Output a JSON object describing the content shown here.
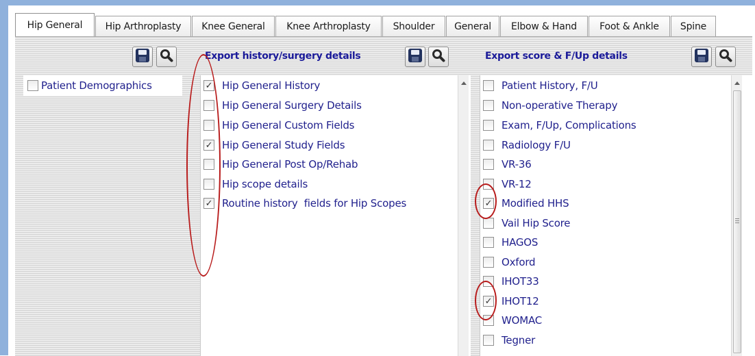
{
  "tabs": [
    {
      "label": "Hip General",
      "active": true
    },
    {
      "label": "Hip Arthroplasty",
      "active": false
    },
    {
      "label": "Knee General",
      "active": false
    },
    {
      "label": "Knee Arthroplasty",
      "active": false
    },
    {
      "label": "Shoulder",
      "active": false
    },
    {
      "label": "General",
      "active": false
    },
    {
      "label": "Elbow & Hand",
      "active": false
    },
    {
      "label": "Foot & Ankle",
      "active": false
    },
    {
      "label": "Spine",
      "active": false
    }
  ],
  "toolbar": {
    "icons": [
      "save-icon",
      "search-icon"
    ]
  },
  "left_panel": {
    "items": [
      {
        "label": "Patient Demographics",
        "checked": false
      }
    ]
  },
  "history_panel": {
    "title": "Export history/surgery details",
    "items": [
      {
        "label": "Hip General History",
        "checked": true
      },
      {
        "label": "Hip General Surgery Details",
        "checked": false
      },
      {
        "label": "Hip General Custom Fields",
        "checked": false
      },
      {
        "label": "Hip General Study Fields",
        "checked": true
      },
      {
        "label": "Hip General Post Op/Rehab",
        "checked": false
      },
      {
        "label": "Hip scope details",
        "checked": false
      },
      {
        "label": "Routine history  fields for Hip Scopes",
        "checked": true
      }
    ]
  },
  "score_panel": {
    "title": "Export score & F/Up details",
    "items": [
      {
        "label": "Patient History, F/U",
        "checked": false
      },
      {
        "label": "Non-operative Therapy",
        "checked": false
      },
      {
        "label": "Exam, F/Up, Complications",
        "checked": false
      },
      {
        "label": "Radiology F/U",
        "checked": false
      },
      {
        "label": "VR-36",
        "checked": false
      },
      {
        "label": "VR-12",
        "checked": false
      },
      {
        "label": "Modified HHS",
        "checked": true
      },
      {
        "label": "Vail Hip Score",
        "checked": false
      },
      {
        "label": "HAGOS",
        "checked": false
      },
      {
        "label": "Oxford",
        "checked": false
      },
      {
        "label": "IHOT33",
        "checked": false
      },
      {
        "label": "IHOT12",
        "checked": true
      },
      {
        "label": "WOMAC",
        "checked": false
      },
      {
        "label": "Tegner",
        "checked": false
      }
    ]
  },
  "colors": {
    "item_text": "#1f1f8c",
    "title_text": "#1a1a99",
    "annotation": "#b81c1c",
    "window_edge": "#8fb1dc"
  }
}
